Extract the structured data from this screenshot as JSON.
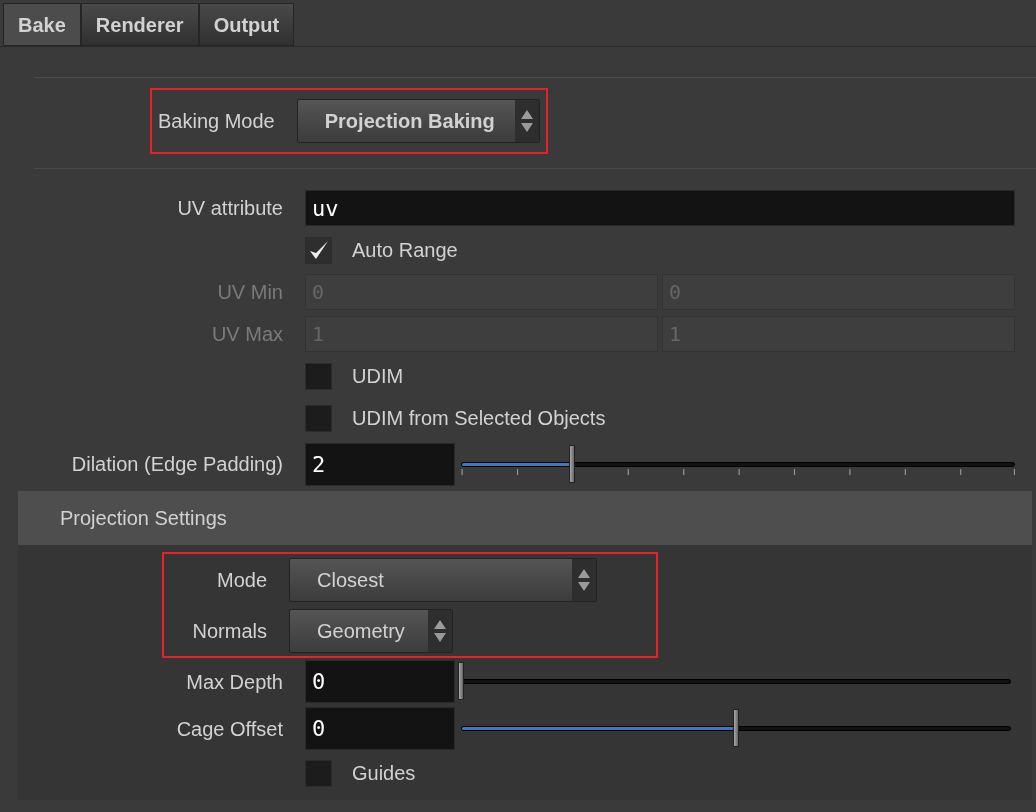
{
  "tabs": [
    {
      "label": "Bake",
      "selected": true
    },
    {
      "label": "Renderer",
      "selected": false
    },
    {
      "label": "Output",
      "selected": false
    }
  ],
  "baking_mode": {
    "label": "Baking Mode",
    "value": "Projection Baking",
    "highlighted": true
  },
  "parameters": [
    {
      "kind": "text",
      "label": "UV attribute",
      "value": "uv"
    },
    {
      "kind": "checkbox",
      "label": "Auto Range",
      "checked": true
    },
    {
      "kind": "vector",
      "label": "UV Min",
      "disabled": true,
      "values": [
        "0",
        "0"
      ]
    },
    {
      "kind": "vector",
      "label": "UV Max",
      "disabled": true,
      "values": [
        "1",
        "1"
      ]
    },
    {
      "kind": "checkbox",
      "label": "UDIM",
      "checked": false
    },
    {
      "kind": "checkbox",
      "label": "UDIM from Selected Objects",
      "checked": false
    },
    {
      "kind": "slider",
      "label": "Dilation (Edge Padding)",
      "value": "2",
      "level": 0.2,
      "ticks": true
    }
  ],
  "projection_settings": {
    "title": "Projection Settings",
    "highlighted": true,
    "highlighted_parameters": [
      {
        "kind": "menu",
        "label": "Mode",
        "value": "Closest"
      },
      {
        "kind": "menu",
        "label": "Normals",
        "value": "Geometry"
      }
    ],
    "parameters": [
      {
        "kind": "slider",
        "label": "Max Depth",
        "value": "0",
        "level": 0,
        "ticks": false
      },
      {
        "kind": "slider",
        "label": "Cage Offset",
        "value": "0",
        "level": 0.5,
        "ticks": false
      },
      {
        "kind": "checkbox",
        "label": "Guides",
        "checked": false
      }
    ]
  }
}
